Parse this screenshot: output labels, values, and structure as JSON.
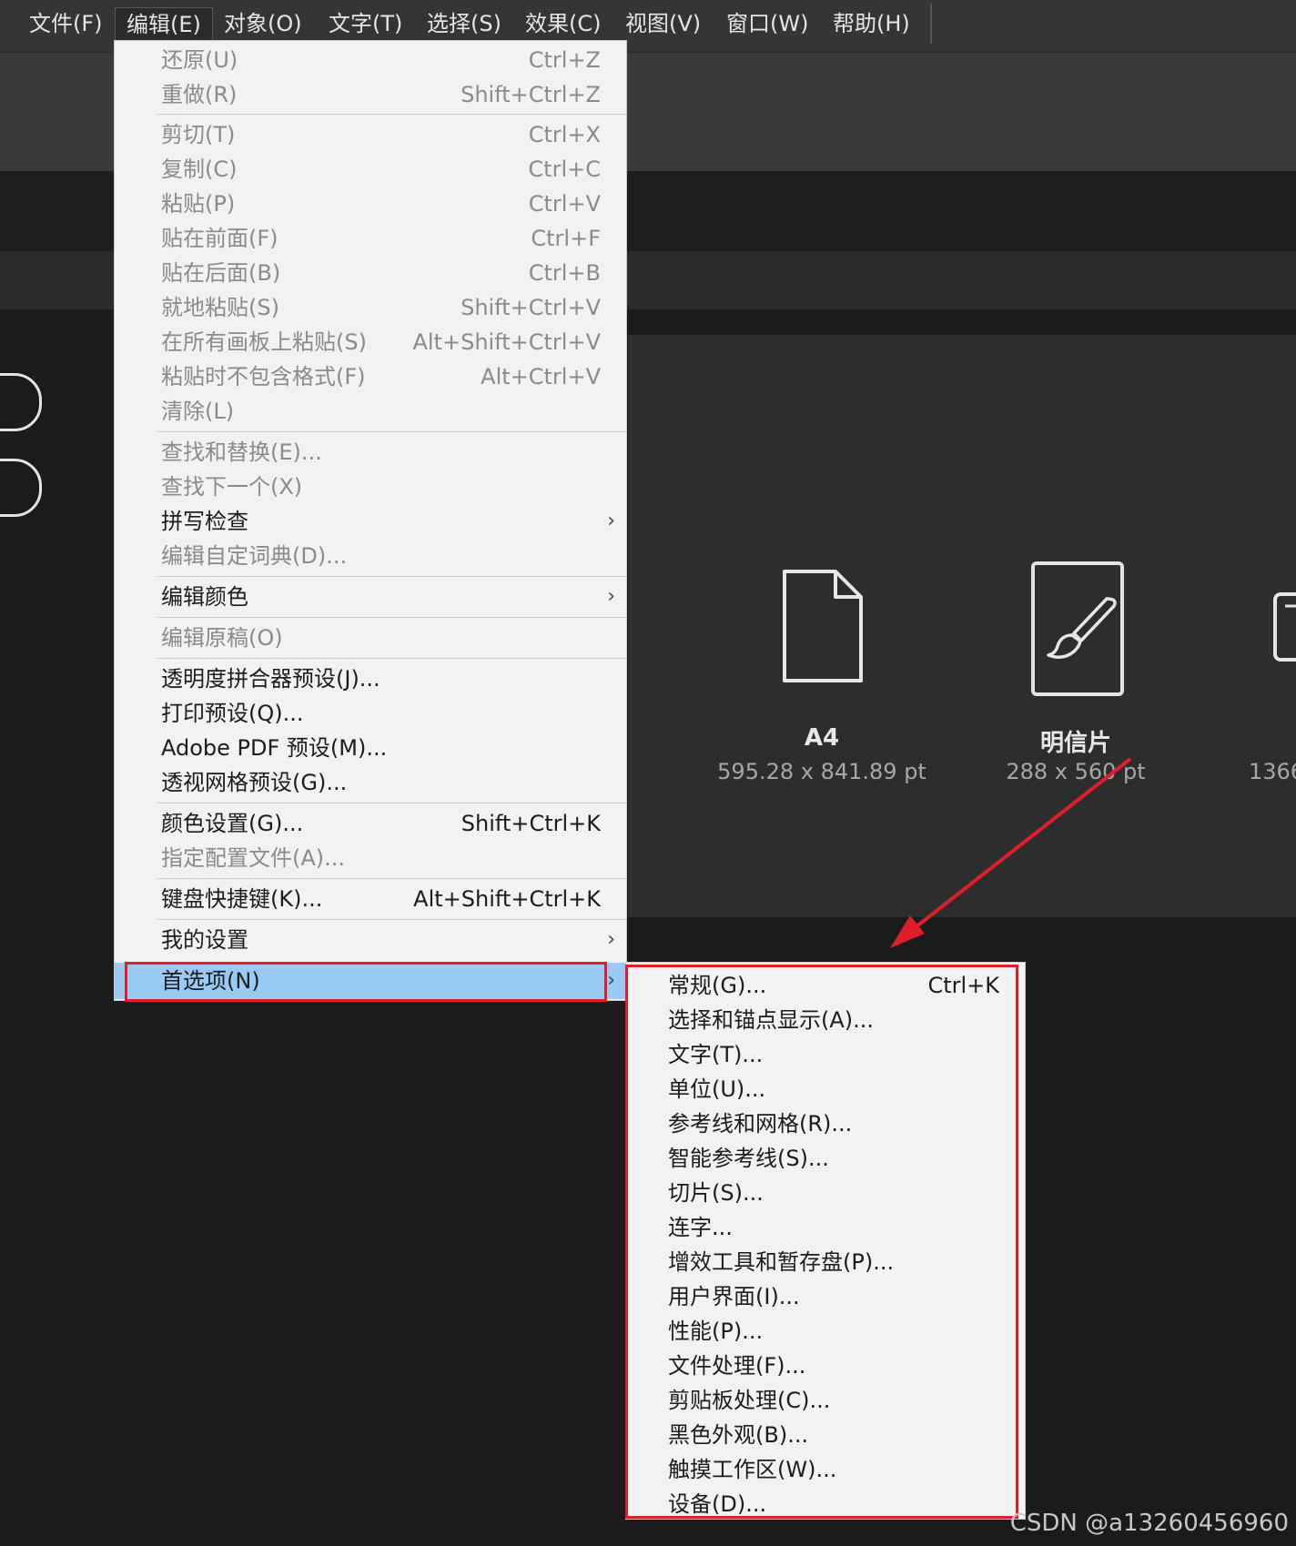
{
  "menubar": {
    "items": [
      "文件(F)",
      "编辑(E)",
      "对象(O)",
      "文字(T)",
      "选择(S)",
      "效果(C)",
      "视图(V)",
      "窗口(W)",
      "帮助(H)"
    ]
  },
  "edit_menu": {
    "items": [
      {
        "label": "还原(U)",
        "shortcut": "Ctrl+Z"
      },
      {
        "label": "重做(R)",
        "shortcut": "Shift+Ctrl+Z"
      },
      {
        "label": "剪切(T)",
        "shortcut": "Ctrl+X"
      },
      {
        "label": "复制(C)",
        "shortcut": "Ctrl+C"
      },
      {
        "label": "粘贴(P)",
        "shortcut": "Ctrl+V"
      },
      {
        "label": "贴在前面(F)",
        "shortcut": "Ctrl+F"
      },
      {
        "label": "贴在后面(B)",
        "shortcut": "Ctrl+B"
      },
      {
        "label": "就地粘贴(S)",
        "shortcut": "Shift+Ctrl+V"
      },
      {
        "label": "在所有画板上粘贴(S)",
        "shortcut": "Alt+Shift+Ctrl+V"
      },
      {
        "label": "粘贴时不包含格式(F)",
        "shortcut": "Alt+Ctrl+V"
      },
      {
        "label": "清除(L)",
        "shortcut": ""
      },
      {
        "label": "查找和替换(E)...",
        "shortcut": ""
      },
      {
        "label": "查找下一个(X)",
        "shortcut": ""
      },
      {
        "label": "拼写检查",
        "shortcut": ""
      },
      {
        "label": "编辑自定词典(D)...",
        "shortcut": ""
      },
      {
        "label": "编辑颜色",
        "shortcut": ""
      },
      {
        "label": "编辑原稿(O)",
        "shortcut": ""
      },
      {
        "label": "透明度拼合器预设(J)...",
        "shortcut": ""
      },
      {
        "label": "打印预设(Q)...",
        "shortcut": ""
      },
      {
        "label": "Adobe PDF 预设(M)...",
        "shortcut": ""
      },
      {
        "label": "透视网格预设(G)...",
        "shortcut": ""
      },
      {
        "label": "颜色设置(G)...",
        "shortcut": "Shift+Ctrl+K"
      },
      {
        "label": "指定配置文件(A)...",
        "shortcut": ""
      },
      {
        "label": "键盘快捷键(K)...",
        "shortcut": "Alt+Shift+Ctrl+K"
      },
      {
        "label": "我的设置",
        "shortcut": ""
      },
      {
        "label": "首选项(N)",
        "shortcut": ""
      }
    ]
  },
  "preferences_submenu": {
    "items": [
      {
        "label": "常规(G)...",
        "shortcut": "Ctrl+K"
      },
      {
        "label": "选择和锚点显示(A)...",
        "shortcut": ""
      },
      {
        "label": "文字(T)...",
        "shortcut": ""
      },
      {
        "label": "单位(U)...",
        "shortcut": ""
      },
      {
        "label": "参考线和网格(R)...",
        "shortcut": ""
      },
      {
        "label": "智能参考线(S)...",
        "shortcut": ""
      },
      {
        "label": "切片(S)...",
        "shortcut": ""
      },
      {
        "label": "连字...",
        "shortcut": ""
      },
      {
        "label": "增效工具和暂存盘(P)...",
        "shortcut": ""
      },
      {
        "label": "用户界面(I)...",
        "shortcut": ""
      },
      {
        "label": "性能(P)...",
        "shortcut": ""
      },
      {
        "label": "文件处理(F)...",
        "shortcut": ""
      },
      {
        "label": "剪贴板处理(C)...",
        "shortcut": ""
      },
      {
        "label": "黑色外观(B)...",
        "shortcut": ""
      },
      {
        "label": "触摸工作区(W)...",
        "shortcut": ""
      },
      {
        "label": "设备(D)...",
        "shortcut": ""
      }
    ]
  },
  "presets": [
    {
      "name": "A4",
      "size": "595.28 x 841.89 pt",
      "icon": "document-icon"
    },
    {
      "name": "明信片",
      "size": "288 x 560 pt",
      "icon": "brush-icon"
    },
    {
      "name": "",
      "size": "1366",
      "icon": "device-icon"
    }
  ],
  "colors": {
    "highlight": "#99c9f5",
    "annotation_red": "#e01e2b",
    "menu_bg": "#f2f2f2"
  },
  "watermark": "CSDN @a13260456960"
}
